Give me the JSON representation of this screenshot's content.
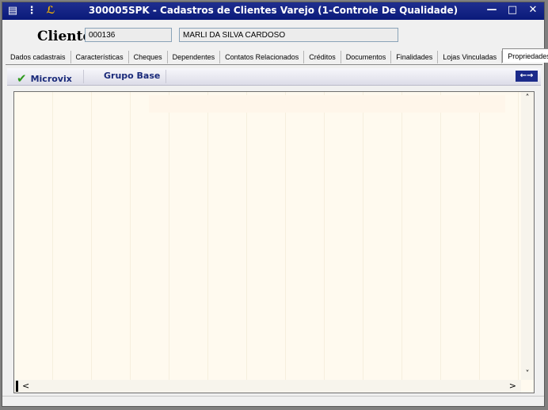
{
  "window": {
    "title": "300005SPK - Cadastros de Clientes Varejo (1-Controle De Qualidade)",
    "icons": [
      "menu-icon",
      "traffic-light-icon",
      "wrench-icon"
    ],
    "controls": {
      "minimize": "—",
      "maximize": "□",
      "close": "✕"
    },
    "colors": {
      "titlebar": "#0a1a7a",
      "content_bg": "#fffaef",
      "accent": "#1a2a7a"
    }
  },
  "client": {
    "label": "Cliente",
    "code": "000136",
    "name": "MARLI DA SILVA CARDOSO"
  },
  "tabs": [
    {
      "label": "Dados cadastrais"
    },
    {
      "label": "Características"
    },
    {
      "label": "Cheques"
    },
    {
      "label": "Dependentes"
    },
    {
      "label": "Contatos Relacionados"
    },
    {
      "label": "Créditos"
    },
    {
      "label": "Documentos"
    },
    {
      "label": "Finalidades"
    },
    {
      "label": "Lojas Vinculadas"
    },
    {
      "label": "Propriedades",
      "active": true
    }
  ],
  "toolbar": {
    "microvix": "Microvix",
    "grupo_base": "Grupo Base",
    "nav_arrows": "←→"
  },
  "scroll": {
    "up": "˄",
    "down": "˅",
    "left": "<",
    "right": ">"
  }
}
